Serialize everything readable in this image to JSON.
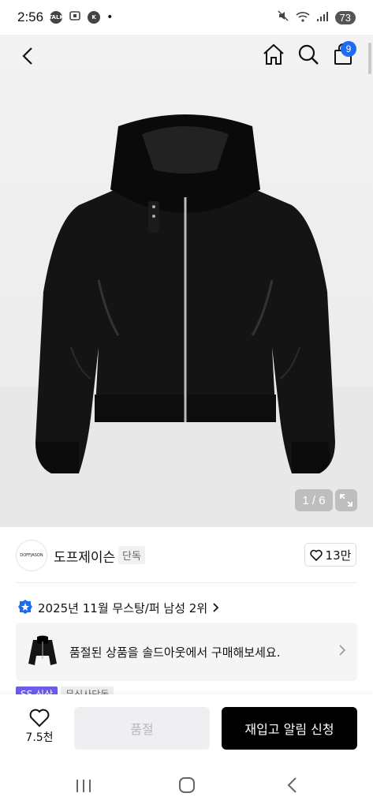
{
  "status_bar": {
    "time": "2:56",
    "talk_icon_text": "TALK",
    "battery": "73"
  },
  "topbar": {
    "cart_count": "9"
  },
  "gallery": {
    "page_indicator": "1 / 6"
  },
  "brand": {
    "logo_text": "DOFFJASON",
    "name": "도프제이슨",
    "tag": "단독",
    "likes": "13만"
  },
  "ranking": {
    "text": "2025년 11월 무스탕/퍼 남성 2위"
  },
  "soldout_banner": {
    "text": "품절된 상품을 솔드아웃에서 구매해보세요."
  },
  "tags": [
    "SS 신상",
    "무신사단독"
  ],
  "bottom_bar": {
    "wish_count": "7.5천",
    "soldout_label": "품절",
    "restock_label": "재입고 알림 신청"
  },
  "colors": {
    "cart_badge": "#1d6bf3",
    "rank_badge": "#1d6bf3",
    "tag_ss": "#6c5ce7"
  }
}
